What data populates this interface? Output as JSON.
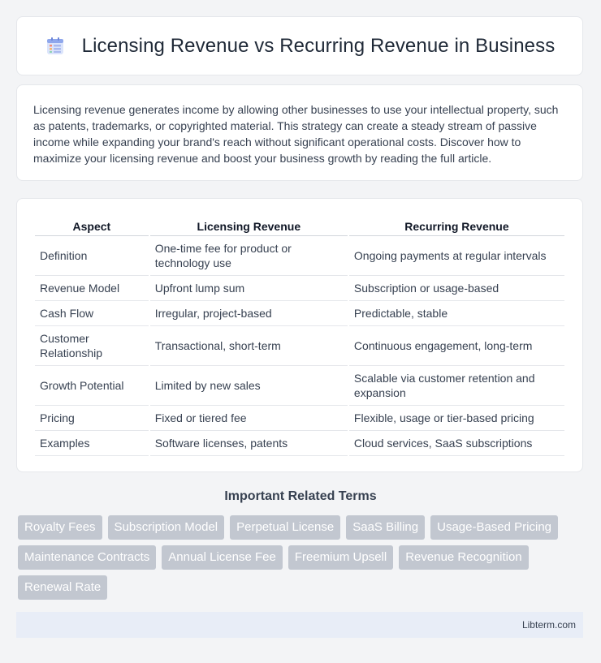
{
  "header": {
    "title": "Licensing Revenue vs Recurring Revenue in Business",
    "icon": "document-list-icon"
  },
  "intro": {
    "text": "Licensing revenue generates income by allowing other businesses to use your intellectual property, such as patents, trademarks, or copyrighted material. This strategy can create a steady stream of passive income while expanding your brand's reach without significant operational costs. Discover how to maximize your licensing revenue and boost your business growth by reading the full article."
  },
  "table": {
    "headers": [
      "Aspect",
      "Licensing Revenue",
      "Recurring Revenue"
    ],
    "rows": [
      [
        "Definition",
        "One-time fee for product or technology use",
        "Ongoing payments at regular intervals"
      ],
      [
        "Revenue Model",
        "Upfront lump sum",
        "Subscription or usage-based"
      ],
      [
        "Cash Flow",
        "Irregular, project-based",
        "Predictable, stable"
      ],
      [
        "Customer Relationship",
        "Transactional, short-term",
        "Continuous engagement, long-term"
      ],
      [
        "Growth Potential",
        "Limited by new sales",
        "Scalable via customer retention and expansion"
      ],
      [
        "Pricing",
        "Fixed or tiered fee",
        "Flexible, usage or tier-based pricing"
      ],
      [
        "Examples",
        "Software licenses, patents",
        "Cloud services, SaaS subscriptions"
      ]
    ]
  },
  "related": {
    "title": "Important Related Terms",
    "tags": [
      "Royalty Fees",
      "Subscription Model",
      "Perpetual License",
      "SaaS Billing",
      "Usage-Based Pricing",
      "Maintenance Contracts",
      "Annual License Fee",
      "Freemium Upsell",
      "Revenue Recognition",
      "Renewal Rate"
    ]
  },
  "footer": {
    "site": "Libterm.com"
  },
  "colors": {
    "background": "#f3f4f6",
    "tag": "#c2c7d0",
    "footer": "#e8edf7"
  }
}
